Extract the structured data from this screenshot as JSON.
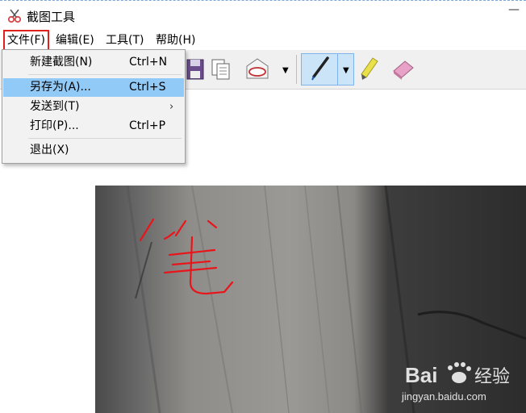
{
  "window": {
    "title": "截图工具",
    "minimize": "—"
  },
  "menubar": {
    "items": [
      {
        "label": "文件(F)"
      },
      {
        "label": "编辑(E)"
      },
      {
        "label": "工具(T)"
      },
      {
        "label": "帮助(H)"
      }
    ]
  },
  "file_menu": {
    "items": [
      {
        "label": "新建截图(N)",
        "shortcut": "Ctrl+N"
      },
      {
        "label": "另存为(A)...",
        "shortcut": "Ctrl+S",
        "highlighted": true
      },
      {
        "label": "发送到(T)",
        "submenu_arrow": "›"
      },
      {
        "label": "打印(P)...",
        "shortcut": "Ctrl+P"
      },
      {
        "label": "退出(X)"
      }
    ]
  },
  "toolbar": {
    "icons": [
      "save-icon",
      "copy-icon",
      "email-icon",
      "pen-icon",
      "highlighter-icon",
      "eraser-icon"
    ],
    "dropdown_arrow": "▼"
  },
  "watermark": {
    "brand": "Bai",
    "brand2": "经验",
    "url": "jingyan.baidu.com"
  },
  "colors": {
    "highlight": "#91c9f7",
    "red_box": "#e0201b",
    "ink": "#e8151b"
  }
}
